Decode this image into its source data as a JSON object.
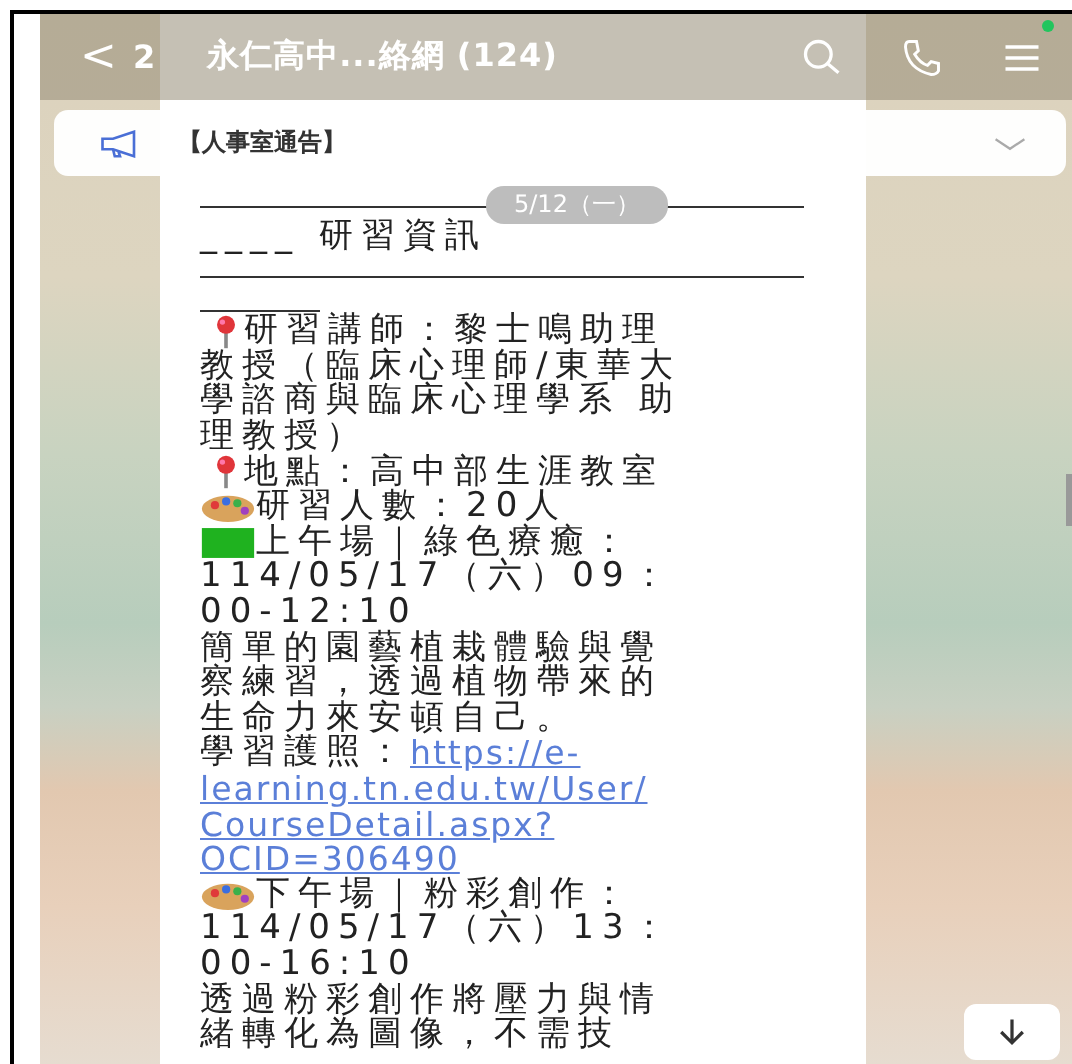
{
  "header": {
    "back": "<",
    "unread": "2",
    "title": "永仁高中...絡網 (124)",
    "menu_badge": true
  },
  "notice": {
    "text": "【人事室通告】"
  },
  "date_badge": "5/12（一）",
  "message": {
    "lines": [
      {
        "kind": "rule"
      },
      {
        "kind": "heading",
        "segments": [
          {
            "kind": "text",
            "text": "____ 研習資訊"
          }
        ]
      },
      {
        "kind": "rule"
      },
      {
        "kind": "short_rule"
      },
      {
        "kind": "line",
        "segments": [
          {
            "kind": "pin"
          },
          {
            "kind": "text",
            "text": " 研習講師：黎士鳴助理"
          }
        ]
      },
      {
        "kind": "line",
        "segments": [
          {
            "kind": "text",
            "text": "教授（臨床心理師/東華大"
          }
        ]
      },
      {
        "kind": "line",
        "segments": [
          {
            "kind": "text",
            "text": "學諮商與臨床心理學系 助"
          }
        ]
      },
      {
        "kind": "line",
        "segments": [
          {
            "kind": "text",
            "text": "理教授）"
          }
        ]
      },
      {
        "kind": "line",
        "segments": [
          {
            "kind": "pin"
          },
          {
            "kind": "text",
            "text": " 地點：高中部生涯教室"
          }
        ]
      },
      {
        "kind": "line",
        "segments": [
          {
            "kind": "palette"
          },
          {
            "kind": "text",
            "text": "研習人數：20人"
          }
        ]
      },
      {
        "kind": "line",
        "segments": [
          {
            "kind": "square"
          },
          {
            "kind": "text",
            "text": " 上午場｜綠色療癒："
          }
        ]
      },
      {
        "kind": "line",
        "segments": [
          {
            "kind": "text",
            "text": "114/05/17（六）09："
          }
        ]
      },
      {
        "kind": "line",
        "segments": [
          {
            "kind": "text",
            "text": "00-12:10"
          }
        ]
      },
      {
        "kind": "line",
        "segments": [
          {
            "kind": "text",
            "text": "簡單的園藝植栽體驗與覺"
          }
        ]
      },
      {
        "kind": "line",
        "segments": [
          {
            "kind": "text",
            "text": "察練習，透過植物帶來的"
          }
        ]
      },
      {
        "kind": "line",
        "segments": [
          {
            "kind": "text",
            "text": "生命力來安頓自己。"
          }
        ]
      },
      {
        "kind": "line",
        "segments": [
          {
            "kind": "text",
            "text": "學習護照："
          },
          {
            "kind": "link",
            "text": "https://e-"
          }
        ]
      },
      {
        "kind": "line",
        "segments": [
          {
            "kind": "link",
            "text": "learning.tn.edu.tw/User/"
          }
        ]
      },
      {
        "kind": "line",
        "segments": [
          {
            "kind": "link",
            "text": "CourseDetail.aspx?"
          }
        ]
      },
      {
        "kind": "line",
        "segments": [
          {
            "kind": "link",
            "text": "OCID=306490"
          }
        ]
      },
      {
        "kind": "line",
        "segments": [
          {
            "kind": "palette"
          },
          {
            "kind": "text",
            "text": " 下午場｜粉彩創作："
          }
        ]
      },
      {
        "kind": "line",
        "segments": [
          {
            "kind": "text",
            "text": "114/05/17（六）13："
          }
        ]
      },
      {
        "kind": "line",
        "segments": [
          {
            "kind": "text",
            "text": "00-16:10"
          }
        ]
      },
      {
        "kind": "line",
        "segments": [
          {
            "kind": "text",
            "text": "透過粉彩創作將壓力與情"
          }
        ]
      },
      {
        "kind": "line",
        "segments": [
          {
            "kind": "text",
            "text": "緒轉化為圖像，不需技"
          }
        ]
      }
    ]
  }
}
